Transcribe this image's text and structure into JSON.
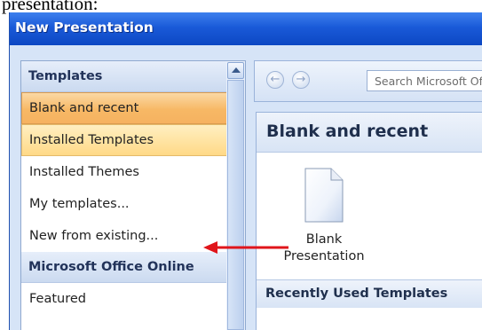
{
  "caption_fragment": "presentation:",
  "window": {
    "title": "New Presentation"
  },
  "nav": {
    "header_templates": "Templates",
    "items": [
      {
        "label": "Blank and recent",
        "state": "selected"
      },
      {
        "label": "Installed Templates",
        "state": "hover"
      },
      {
        "label": "Installed Themes",
        "state": "normal"
      },
      {
        "label": "My templates...",
        "state": "normal"
      },
      {
        "label": "New from existing...",
        "state": "normal"
      }
    ],
    "header_online": "Microsoft Office Online",
    "online_items": [
      {
        "label": "Featured"
      }
    ]
  },
  "toolbar": {
    "back_icon": "back-arrow-icon",
    "forward_icon": "forward-arrow-icon",
    "search_placeholder": "Search Microsoft Office Online"
  },
  "content": {
    "header": "Blank and recent",
    "tile": {
      "label_line1": "Blank",
      "label_line2": "Presentation",
      "icon": "blank-document-icon"
    },
    "section_header": "Recently Used Templates"
  },
  "colors": {
    "titlebar": "#1a5ad8",
    "selected": "#f7b865",
    "hover": "#ffd987",
    "annotation_arrow": "#e0151b"
  }
}
